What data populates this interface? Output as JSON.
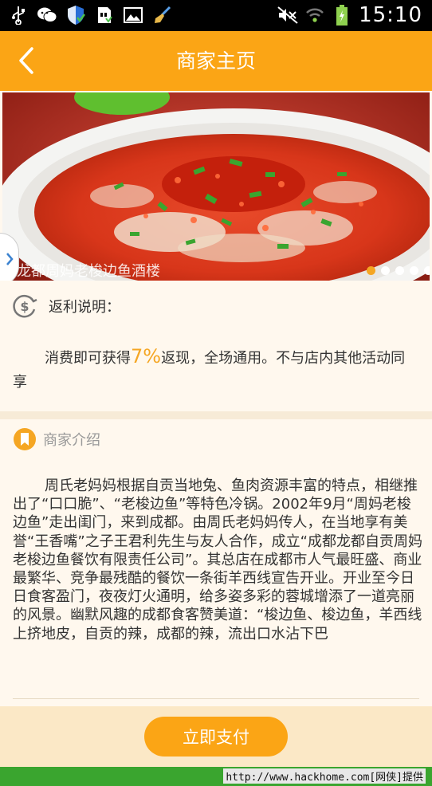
{
  "status_bar": {
    "time": "15:10",
    "left_icons": [
      "usb-icon",
      "wechat-icon",
      "shield-icon",
      "sd-card-icon",
      "image-icon",
      "broom-icon"
    ],
    "right_icons": [
      "mute-icon",
      "wifi-icon",
      "battery-icon"
    ]
  },
  "header": {
    "title": "商家主页",
    "back_icon": "chevron-left-icon",
    "background": "#fba515"
  },
  "banner": {
    "caption": "龙都周妈老梭边鱼酒楼",
    "dot_count": 5,
    "active_dot": 0,
    "side_tab_icon": "chevron-right-icon"
  },
  "rebate": {
    "title": "返利说明：",
    "text_before": "消费即可获得",
    "percent": "7%",
    "text_after": "返现，全场通用。不与店内其他活动同享",
    "icon": "dollar-circle-icon"
  },
  "intro": {
    "title": "商家介绍",
    "icon": "bookmark-icon",
    "text": "周氏老妈妈根据自贡当地兔、鱼肉资源丰富的特点，相继推出了“口口脆”、“老梭边鱼”等特色冷锅。2002年9月“周妈老梭边鱼”走出闺门，来到成都。由周氏老妈妈传人，在当地享有美誉“王香嘴”之子王君利先生与友人合作，成立“成都龙都自贡周妈老梭边鱼餐饮有限责任公司”。其总店在成都市人气最旺盛、商业最繁华、竞争最残酷的餐饮一条街羊西线宣告开业。开业至今日日食客盈门，夜夜灯火通明，给多姿多彩的蓉城增添了一道亮丽的风景。幽默风趣的成都食客赞美道：“梭边鱼、梭边鱼，羊西线上挤地皮，自贡的辣，成都的辣，流出口水沾下巴"
  },
  "pay_button": {
    "label": "立即支付"
  },
  "watermark": "http://www.hackhome.com[网侠]提供"
}
